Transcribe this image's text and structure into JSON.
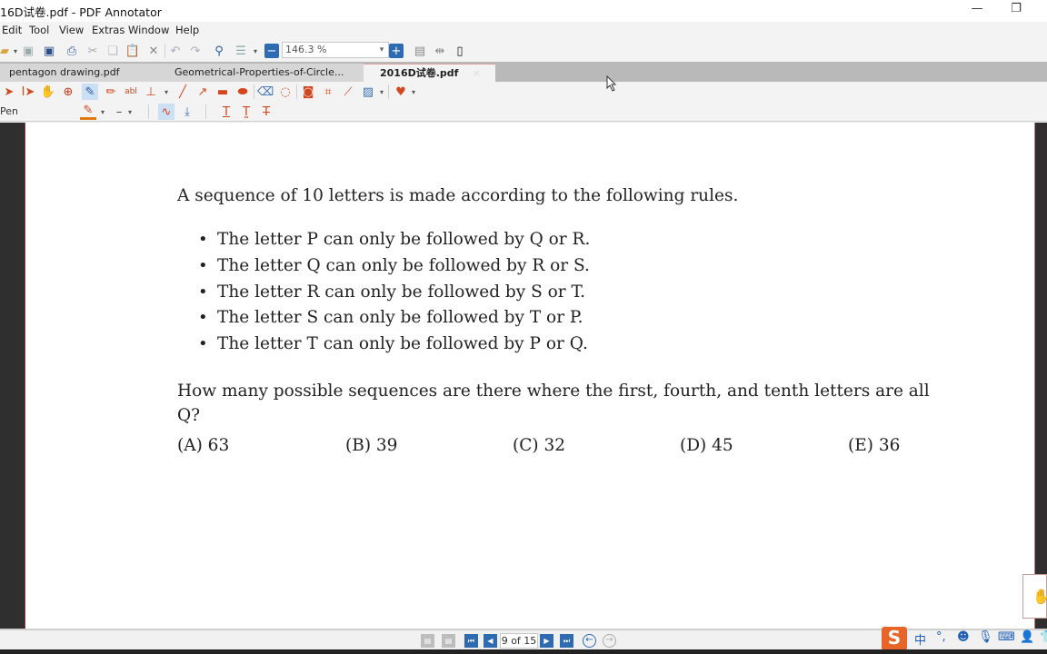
{
  "window": {
    "title": "16D试卷.pdf - PDF Annotator",
    "minimize_glyph": "—",
    "restore_glyph": "❐"
  },
  "menu": [
    "Edit",
    "Tool",
    "View",
    "Extras",
    "Window",
    "Help"
  ],
  "toolbar": {
    "zoom_value": "146.3 %"
  },
  "tabs": [
    {
      "label": "pentagon drawing.pdf",
      "active": false
    },
    {
      "label": "Geometrical-Properties-of-Circle...",
      "active": false
    },
    {
      "label": "2016D试卷.pdf",
      "active": true
    }
  ],
  "tool_options": {
    "current_tool_label": "Pen"
  },
  "document": {
    "intro": "A sequence of 10 letters is made according to the following rules.",
    "rules": [
      "The letter P can only be followed by Q or R.",
      "The letter Q can only be followed by R or S.",
      "The letter R can only be followed by S or T.",
      "The letter S can only be followed by T or P.",
      "The letter T can only be followed by P or Q."
    ],
    "question": "How many possible sequences are there where the first, fourth, and tenth letters are all Q?",
    "choices": [
      "(A) 63",
      "(B) 39",
      "(C) 32",
      "(D) 45",
      "(E) 36"
    ]
  },
  "navigation": {
    "page_indicator": "9 of 15"
  },
  "ime": {
    "logo": "S",
    "mode": "中",
    "punct": "°,"
  },
  "colors": {
    "accent_tool": "#d2471f",
    "nav_blue": "#2e6bb0",
    "tab_active_border": "#d89c9c"
  }
}
